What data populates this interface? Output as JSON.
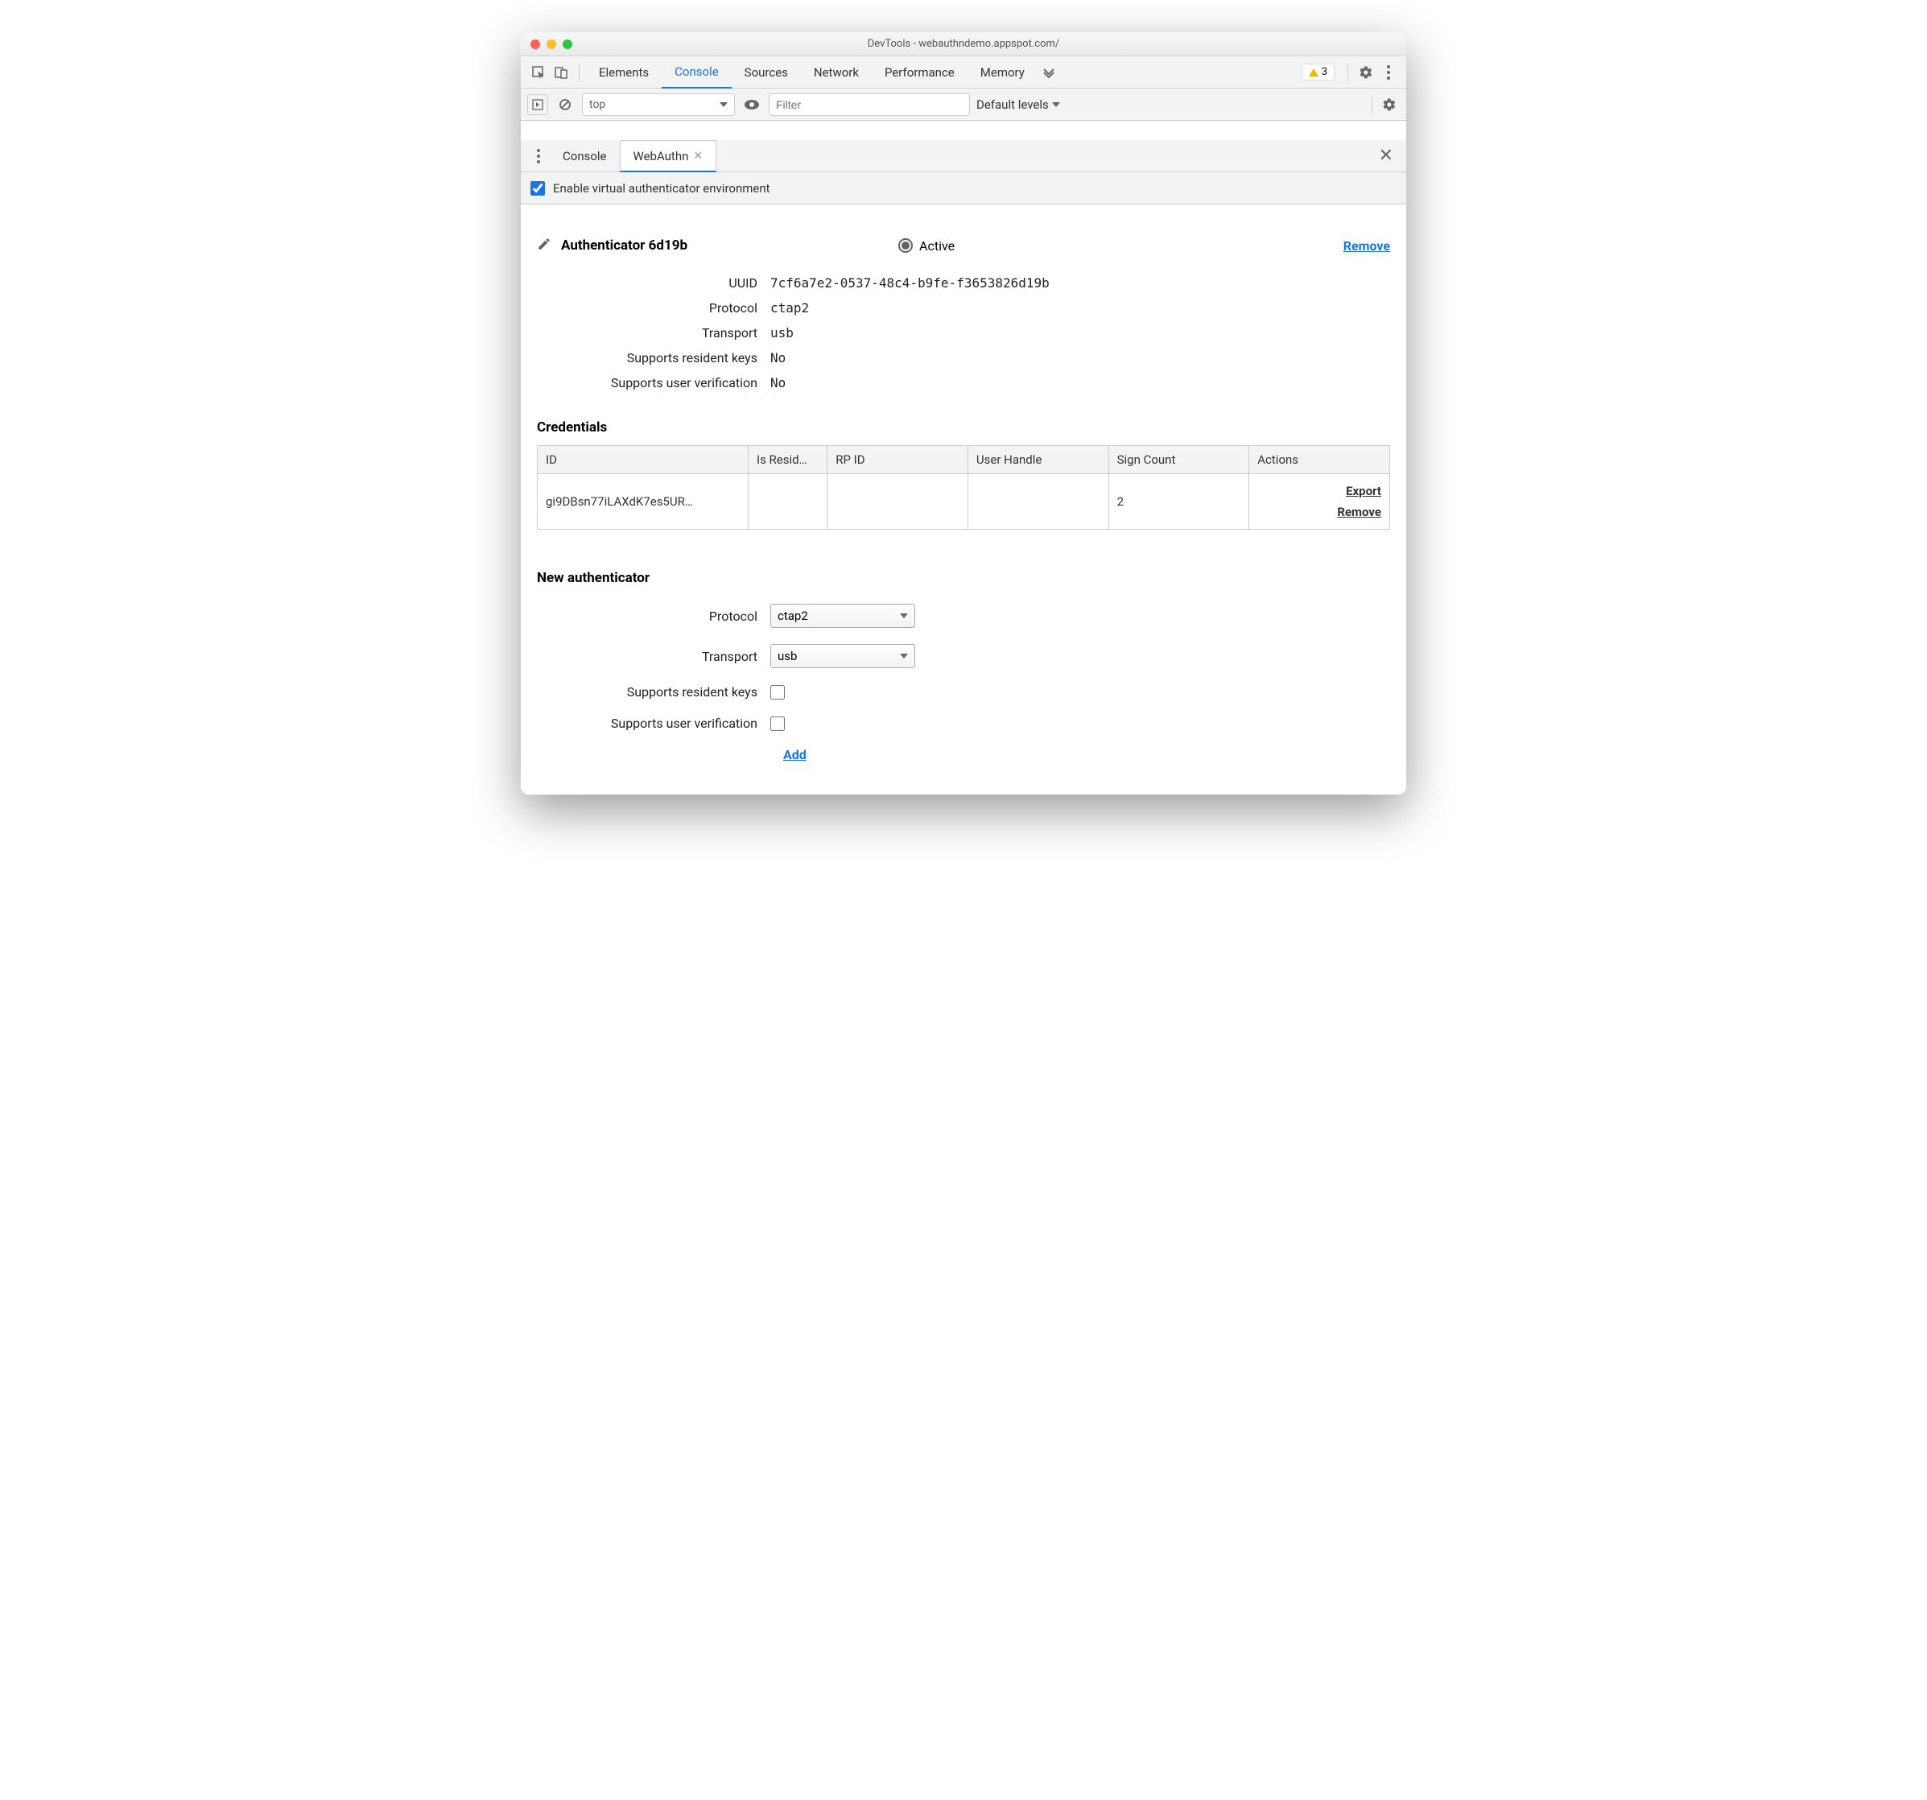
{
  "window": {
    "title": "DevTools - webauthndemo.appspot.com/"
  },
  "main_tabs": {
    "items": [
      "Elements",
      "Console",
      "Sources",
      "Network",
      "Performance",
      "Memory"
    ],
    "active": "Console",
    "warnings_count": "3"
  },
  "console_toolbar": {
    "context": "top",
    "filter_placeholder": "Filter",
    "levels": "Default levels"
  },
  "drawer": {
    "tabs": [
      "Console",
      "WebAuthn"
    ],
    "active": "WebAuthn"
  },
  "enable": {
    "label": "Enable virtual authenticator environment",
    "checked": true
  },
  "authenticator": {
    "name": "Authenticator 6d19b",
    "active_label": "Active",
    "remove_label": "Remove",
    "props": {
      "uuid_label": "UUID",
      "uuid_value": "7cf6a7e2-0537-48c4-b9fe-f3653826d19b",
      "protocol_label": "Protocol",
      "protocol_value": "ctap2",
      "transport_label": "Transport",
      "transport_value": "usb",
      "resident_label": "Supports resident keys",
      "resident_value": "No",
      "userverif_label": "Supports user verification",
      "userverif_value": "No"
    }
  },
  "credentials": {
    "title": "Credentials",
    "headers": {
      "id": "ID",
      "is_resident": "Is Resid…",
      "rp_id": "RP ID",
      "user_handle": "User Handle",
      "sign_count": "Sign Count",
      "actions": "Actions"
    },
    "rows": [
      {
        "id": "gi9DBsn77iLAXdK7es5UR…",
        "is_resident": "",
        "rp_id": "",
        "user_handle": "",
        "sign_count": "2",
        "export": "Export",
        "remove": "Remove"
      }
    ]
  },
  "new_auth": {
    "title": "New authenticator",
    "protocol_label": "Protocol",
    "protocol_value": "ctap2",
    "transport_label": "Transport",
    "transport_value": "usb",
    "resident_label": "Supports resident keys",
    "userverif_label": "Supports user verification",
    "add_label": "Add"
  }
}
